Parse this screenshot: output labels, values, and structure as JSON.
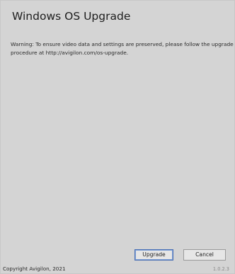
{
  "dialog": {
    "title": "Windows OS Upgrade",
    "warning": "Warning: To ensure video data and settings are preserved, please follow the upgrade procedure at http://avigilon.com/os-upgrade."
  },
  "buttons": {
    "upgrade_label": "Upgrade",
    "cancel_label": "Cancel"
  },
  "footer": {
    "copyright": "Copyright Avigilon, 2021",
    "version": "1.0.2.3"
  },
  "colors": {
    "background": "#d4d4d4",
    "button_background": "#e6e6e6",
    "focus_border": "#4a6fb4"
  }
}
